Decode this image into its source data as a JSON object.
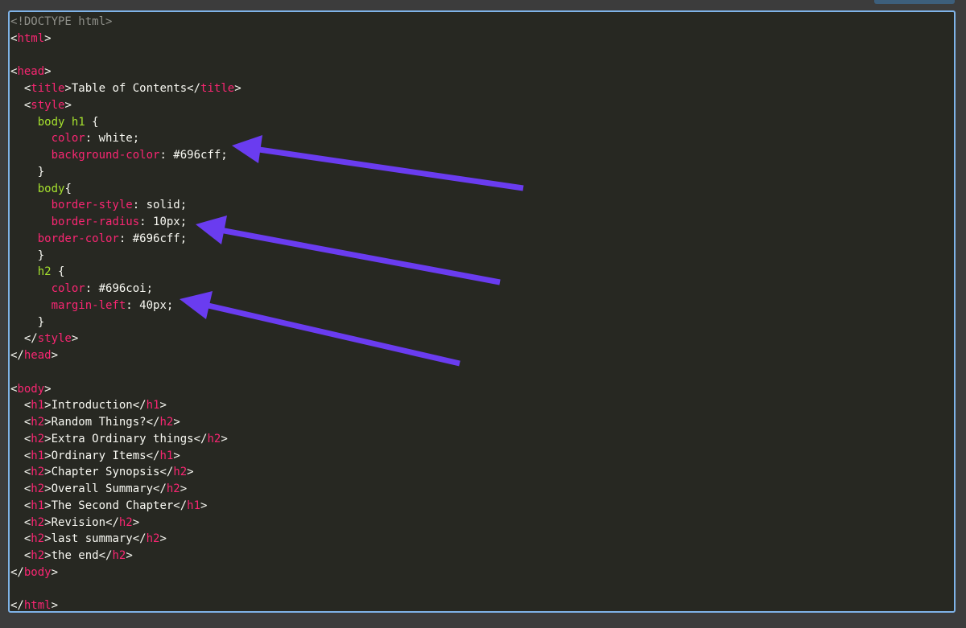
{
  "editor": {
    "accent_color": "#7fb3e8",
    "annotation_color": "#6a3cf0",
    "lines": [
      [
        {
          "t": "<!DOCTYPE html>",
          "c": "doctype"
        }
      ],
      [
        {
          "t": "<",
          "c": "plain"
        },
        {
          "t": "html",
          "c": "tag"
        },
        {
          "t": ">",
          "c": "plain"
        }
      ],
      [],
      [
        {
          "t": "<",
          "c": "plain"
        },
        {
          "t": "head",
          "c": "tag"
        },
        {
          "t": ">",
          "c": "plain"
        }
      ],
      [
        {
          "t": "  <",
          "c": "plain"
        },
        {
          "t": "title",
          "c": "tag"
        },
        {
          "t": ">Table of Contents</",
          "c": "plain"
        },
        {
          "t": "title",
          "c": "tag"
        },
        {
          "t": ">",
          "c": "plain"
        }
      ],
      [
        {
          "t": "  <",
          "c": "plain"
        },
        {
          "t": "style",
          "c": "tag"
        },
        {
          "t": ">",
          "c": "plain"
        }
      ],
      [
        {
          "t": "    ",
          "c": "plain"
        },
        {
          "t": "body h1",
          "c": "selector"
        },
        {
          "t": " {",
          "c": "plain"
        }
      ],
      [
        {
          "t": "      ",
          "c": "plain"
        },
        {
          "t": "color",
          "c": "prop"
        },
        {
          "t": ": white;",
          "c": "plain"
        }
      ],
      [
        {
          "t": "      ",
          "c": "plain"
        },
        {
          "t": "background-color",
          "c": "prop"
        },
        {
          "t": ": #696cff;",
          "c": "plain"
        }
      ],
      [
        {
          "t": "    }",
          "c": "plain"
        }
      ],
      [
        {
          "t": "    ",
          "c": "plain"
        },
        {
          "t": "body",
          "c": "selector"
        },
        {
          "t": "{",
          "c": "plain"
        }
      ],
      [
        {
          "t": "      ",
          "c": "plain"
        },
        {
          "t": "border-style",
          "c": "prop"
        },
        {
          "t": ": solid;",
          "c": "plain"
        }
      ],
      [
        {
          "t": "      ",
          "c": "plain"
        },
        {
          "t": "border-radius",
          "c": "prop"
        },
        {
          "t": ": 10px;",
          "c": "plain"
        }
      ],
      [
        {
          "t": "    ",
          "c": "plain"
        },
        {
          "t": "border-color",
          "c": "prop"
        },
        {
          "t": ": #696cff;",
          "c": "plain"
        }
      ],
      [
        {
          "t": "    }",
          "c": "plain"
        }
      ],
      [
        {
          "t": "    ",
          "c": "plain"
        },
        {
          "t": "h2",
          "c": "selector"
        },
        {
          "t": " {",
          "c": "plain"
        }
      ],
      [
        {
          "t": "      ",
          "c": "plain"
        },
        {
          "t": "color",
          "c": "prop"
        },
        {
          "t": ": #696coi;",
          "c": "plain"
        }
      ],
      [
        {
          "t": "      ",
          "c": "plain"
        },
        {
          "t": "margin-left",
          "c": "prop"
        },
        {
          "t": ": 40px;",
          "c": "plain"
        }
      ],
      [
        {
          "t": "    }",
          "c": "plain"
        }
      ],
      [
        {
          "t": "  </",
          "c": "plain"
        },
        {
          "t": "style",
          "c": "tag"
        },
        {
          "t": ">",
          "c": "plain"
        }
      ],
      [
        {
          "t": "</",
          "c": "plain"
        },
        {
          "t": "head",
          "c": "tag"
        },
        {
          "t": ">",
          "c": "plain"
        }
      ],
      [],
      [
        {
          "t": "<",
          "c": "plain"
        },
        {
          "t": "body",
          "c": "tag"
        },
        {
          "t": ">",
          "c": "plain"
        }
      ],
      [
        {
          "t": "  <",
          "c": "plain"
        },
        {
          "t": "h1",
          "c": "tag"
        },
        {
          "t": ">Introduction</",
          "c": "plain"
        },
        {
          "t": "h1",
          "c": "tag"
        },
        {
          "t": ">",
          "c": "plain"
        }
      ],
      [
        {
          "t": "  <",
          "c": "plain"
        },
        {
          "t": "h2",
          "c": "tag"
        },
        {
          "t": ">Random Things?</",
          "c": "plain"
        },
        {
          "t": "h2",
          "c": "tag"
        },
        {
          "t": ">",
          "c": "plain"
        }
      ],
      [
        {
          "t": "  <",
          "c": "plain"
        },
        {
          "t": "h2",
          "c": "tag"
        },
        {
          "t": ">Extra Ordinary things</",
          "c": "plain"
        },
        {
          "t": "h2",
          "c": "tag"
        },
        {
          "t": ">",
          "c": "plain"
        }
      ],
      [
        {
          "t": "  <",
          "c": "plain"
        },
        {
          "t": "h1",
          "c": "tag"
        },
        {
          "t": ">Ordinary Items</",
          "c": "plain"
        },
        {
          "t": "h1",
          "c": "tag"
        },
        {
          "t": ">",
          "c": "plain"
        }
      ],
      [
        {
          "t": "  <",
          "c": "plain"
        },
        {
          "t": "h2",
          "c": "tag"
        },
        {
          "t": ">Chapter Synopsis</",
          "c": "plain"
        },
        {
          "t": "h2",
          "c": "tag"
        },
        {
          "t": ">",
          "c": "plain"
        }
      ],
      [
        {
          "t": "  <",
          "c": "plain"
        },
        {
          "t": "h2",
          "c": "tag"
        },
        {
          "t": ">Overall Summary</",
          "c": "plain"
        },
        {
          "t": "h2",
          "c": "tag"
        },
        {
          "t": ">",
          "c": "plain"
        }
      ],
      [
        {
          "t": "  <",
          "c": "plain"
        },
        {
          "t": "h1",
          "c": "tag"
        },
        {
          "t": ">The Second Chapter</",
          "c": "plain"
        },
        {
          "t": "h1",
          "c": "tag"
        },
        {
          "t": ">",
          "c": "plain"
        }
      ],
      [
        {
          "t": "  <",
          "c": "plain"
        },
        {
          "t": "h2",
          "c": "tag"
        },
        {
          "t": ">Revision</",
          "c": "plain"
        },
        {
          "t": "h2",
          "c": "tag"
        },
        {
          "t": ">",
          "c": "plain"
        }
      ],
      [
        {
          "t": "  <",
          "c": "plain"
        },
        {
          "t": "h2",
          "c": "tag"
        },
        {
          "t": ">last summary</",
          "c": "plain"
        },
        {
          "t": "h2",
          "c": "tag"
        },
        {
          "t": ">",
          "c": "plain"
        }
      ],
      [
        {
          "t": "  <",
          "c": "plain"
        },
        {
          "t": "h2",
          "c": "tag"
        },
        {
          "t": ">the end</",
          "c": "plain"
        },
        {
          "t": "h2",
          "c": "tag"
        },
        {
          "t": ">",
          "c": "plain"
        }
      ],
      [
        {
          "t": "</",
          "c": "plain"
        },
        {
          "t": "body",
          "c": "tag"
        },
        {
          "t": ">",
          "c": "plain"
        }
      ],
      [],
      [
        {
          "t": "</",
          "c": "plain"
        },
        {
          "t": "html",
          "c": "tag"
        },
        {
          "t": ">",
          "c": "plain"
        }
      ]
    ]
  },
  "annotations": {
    "type": "arrow",
    "count": 3
  }
}
